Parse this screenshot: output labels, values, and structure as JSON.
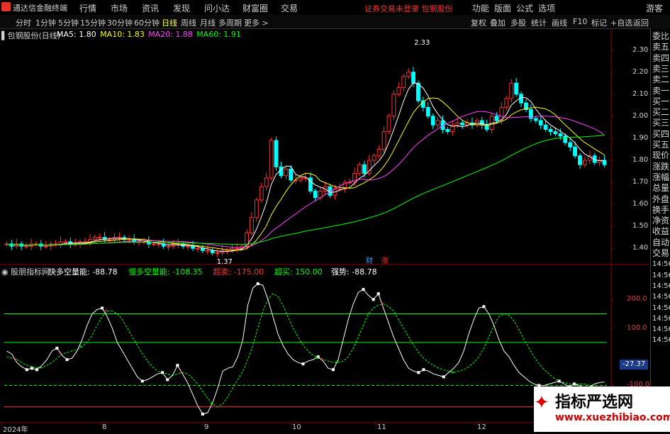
{
  "menubar": {
    "app_name": "通达信金融终端",
    "items": [
      "行情",
      "市场",
      "资讯",
      "发现",
      "问小达",
      "财富圈",
      "交易"
    ],
    "notice": "证券交易未登录  包钢股份",
    "right_items": [
      "功能",
      "版面",
      "公式",
      "选项"
    ],
    "guest": "游客"
  },
  "periodbar": {
    "items": [
      "分时",
      "1分钟",
      "5分钟",
      "15分钟",
      "30分钟",
      "60分钟",
      "日线",
      "周线",
      "月线",
      "多周期",
      "更多 >"
    ],
    "active": "日线",
    "right_items": [
      "复权",
      "叠加",
      "多股",
      "统计",
      "画线",
      "F10",
      "标记",
      "+自选",
      "返回"
    ]
  },
  "chart_data": [
    {
      "type": "candlestick",
      "title": "包钢股份(日线)",
      "indicators": [
        {
          "name": "MA5",
          "value": "1.80",
          "color": "#ffffff"
        },
        {
          "name": "MA10",
          "value": "1.83",
          "color": "#ffff00"
        },
        {
          "name": "MA20",
          "value": "1.88",
          "color": "#ff40ff"
        },
        {
          "name": "MA60",
          "value": "1.91",
          "color": "#00ff00"
        }
      ],
      "ylim": [
        1.33,
        2.36
      ],
      "yticks": [
        "2.30",
        "2.20",
        "2.10",
        "2.00",
        "1.90",
        "1.80",
        "1.70",
        "1.60",
        "1.50",
        "1.40"
      ],
      "high_label": "2.33",
      "low_label": "1.37",
      "markers": [
        "财",
        "涨"
      ],
      "x_labels": [
        "2024年",
        "8",
        "9",
        "10",
        "11",
        "12"
      ],
      "close": [
        1.42,
        1.41,
        1.42,
        1.41,
        1.41,
        1.42,
        1.42,
        1.41,
        1.41,
        1.42,
        1.42,
        1.43,
        1.43,
        1.42,
        1.42,
        1.43,
        1.43,
        1.44,
        1.45,
        1.45,
        1.44,
        1.44,
        1.45,
        1.45,
        1.44,
        1.44,
        1.43,
        1.43,
        1.43,
        1.42,
        1.42,
        1.42,
        1.41,
        1.41,
        1.42,
        1.42,
        1.41,
        1.41,
        1.4,
        1.4,
        1.39,
        1.39,
        1.38,
        1.38,
        1.39,
        1.39,
        1.4,
        1.4,
        1.41,
        1.47,
        1.54,
        1.62,
        1.68,
        1.72,
        1.89,
        1.77,
        1.73,
        1.76,
        1.71,
        1.71,
        1.72,
        1.72,
        1.66,
        1.63,
        1.66,
        1.68,
        1.64,
        1.67,
        1.67,
        1.7,
        1.7,
        1.74,
        1.78,
        1.74,
        1.8,
        1.82,
        1.85,
        1.93,
        2.0,
        2.1,
        2.13,
        2.18,
        2.2,
        2.15,
        2.07,
        2.04,
        2.0,
        1.96,
        1.98,
        1.94,
        1.93,
        1.96,
        1.97,
        1.96,
        1.97,
        1.96,
        1.98,
        1.96,
        1.94,
        2.0,
        1.98,
        2.04,
        2.08,
        2.15,
        2.1,
        2.06,
        2.03,
        1.99,
        1.98,
        1.96,
        1.94,
        1.93,
        1.92,
        1.91,
        1.88,
        1.86,
        1.82,
        1.78,
        1.8,
        1.82,
        1.79,
        1.8,
        1.78
      ]
    },
    {
      "type": "line",
      "title": "股朋指标网",
      "indicators": [
        {
          "name": "快多空量能:",
          "value": "-88.78",
          "color": "#ffffff"
        },
        {
          "name": "慢多空量能:",
          "value": "-108.35",
          "color": "#00ff00"
        },
        {
          "name": "超卖:",
          "value": "-175.00",
          "color": "#ff3030"
        },
        {
          "name": "超买:",
          "value": "150.00",
          "color": "#00ff00"
        },
        {
          "name": "强势:",
          "value": "-88.78",
          "color": "#ffffff"
        }
      ],
      "ylim": [
        -230,
        280
      ],
      "yticks": [
        "200.0",
        "100.0",
        "-100.0"
      ],
      "hlines": [
        150,
        50,
        -100,
        -175
      ],
      "current_value": "-27.37",
      "fast": [
        20,
        10,
        -20,
        -35,
        -45,
        -40,
        -45,
        -30,
        -10,
        20,
        30,
        5,
        -10,
        -5,
        20,
        60,
        110,
        150,
        165,
        170,
        140,
        100,
        50,
        20,
        -10,
        -40,
        -70,
        -85,
        -80,
        -70,
        -60,
        -55,
        -80,
        -65,
        -30,
        -60,
        -90,
        -130,
        -170,
        -200,
        -195,
        -160,
        -110,
        -50,
        -40,
        -35,
        0,
        60,
        180,
        240,
        255,
        250,
        200,
        140,
        80,
        40,
        10,
        -10,
        -20,
        -25,
        -15,
        -10,
        0,
        -15,
        -40,
        -45,
        -10,
        60,
        130,
        185,
        225,
        235,
        215,
        200,
        220,
        170,
        120,
        70,
        30,
        -10,
        -40,
        -50,
        -55,
        -45,
        -50,
        -60,
        -65,
        -70,
        -55,
        -40,
        -20,
        20,
        80,
        130,
        170,
        175,
        150,
        110,
        60,
        20,
        0,
        -30,
        -55,
        -70,
        -85,
        -95,
        -100,
        -100,
        -95,
        -90,
        -85,
        -95,
        -105,
        -95,
        -100,
        -110,
        -105,
        -95,
        -90,
        -88
      ],
      "slow": [
        0,
        -5,
        -10,
        -20,
        -30,
        -35,
        -38,
        -38,
        -30,
        -20,
        -5,
        10,
        15,
        20,
        25,
        35,
        50,
        75,
        110,
        140,
        160,
        160,
        150,
        130,
        100,
        70,
        40,
        10,
        -15,
        -35,
        -50,
        -55,
        -60,
        -65,
        -60,
        -55,
        -60,
        -75,
        -95,
        -120,
        -145,
        -165,
        -175,
        -165,
        -140,
        -110,
        -80,
        -50,
        -10,
        40,
        100,
        160,
        200,
        220,
        210,
        180,
        140,
        100,
        70,
        40,
        20,
        5,
        -5,
        -10,
        -15,
        -20,
        -20,
        -15,
        0,
        30,
        70,
        110,
        150,
        170,
        180,
        185,
        175,
        160,
        130,
        100,
        70,
        40,
        15,
        -5,
        -20,
        -30,
        -40,
        -45,
        -50,
        -55,
        -50,
        -45,
        -35,
        -20,
        0,
        30,
        70,
        110,
        140,
        150,
        145,
        125,
        95,
        60,
        30,
        0,
        -25,
        -45,
        -60,
        -75,
        -85,
        -90,
        -95,
        -95,
        -95,
        -95,
        -100,
        -105,
        -105,
        -108
      ]
    }
  ],
  "rightpanel": {
    "items": [
      "委比",
      "卖五",
      "卖四",
      "卖三",
      "卖二",
      "卖一",
      "买一",
      "买二",
      "买三",
      "买四",
      "买五",
      "现价",
      "涨跌",
      "涨幅",
      "总量",
      "外盘",
      "换手",
      "净资",
      "收益",
      "自动",
      "交易",
      "14:56",
      "14:56",
      "14:56",
      "14:56",
      "14:56",
      "14:56",
      "14:56",
      "14:56"
    ]
  },
  "watermark": {
    "title": "指标严选网",
    "url": "www.xuezhibiao.com"
  },
  "colors": {
    "up": "#ff3030",
    "down": "#00ffff",
    "ma5": "#ffffff",
    "ma10": "#ffff00",
    "ma20": "#ff40ff",
    "ma60": "#00ff00",
    "grid": "#8b0000"
  }
}
